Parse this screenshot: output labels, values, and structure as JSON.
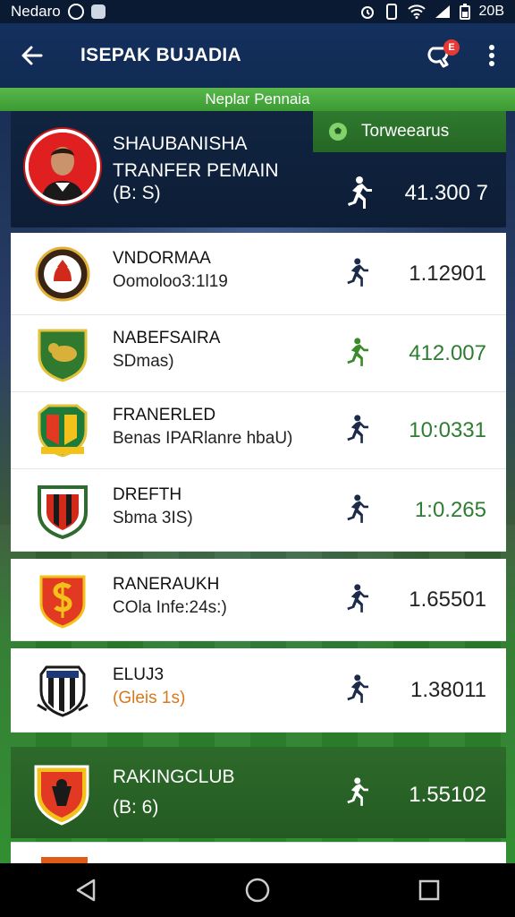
{
  "status_bar": {
    "carrier": "Nedaro",
    "time": "20B"
  },
  "app_bar": {
    "title": "ISEPAK BUJADIA",
    "notification_count": "E"
  },
  "banner": {
    "text": "Neplar Pennaia"
  },
  "player": {
    "name_line1": "SHAUBANISHA",
    "name_line2": "TRANFER PEMAIN",
    "stat": "(B: S)",
    "value": "41.300 7",
    "follow_label": "Torweearus"
  },
  "clubs": [
    {
      "name": "VNDORMAA",
      "sub": "Oomoloo3:1l19",
      "value": "1.12901",
      "value_color": "default",
      "sub_color": "default",
      "runner_color": "#1c2b4a"
    },
    {
      "name": "NABEFSAIRA",
      "sub": "SDmas)",
      "value": "412.007",
      "value_color": "green",
      "sub_color": "default",
      "runner_color": "#3a8a2a"
    },
    {
      "name": "FRANERLED",
      "sub": "Benas IPARlanre hbaU)",
      "value": "10:0331",
      "value_color": "green",
      "sub_color": "default",
      "runner_color": "#1c2b4a"
    },
    {
      "name": "DREFTH",
      "sub": "Sbma 3IS)",
      "value": "1:0.265",
      "value_color": "green",
      "sub_color": "default",
      "runner_color": "#1c2b4a"
    },
    {
      "name": "RANERAUKH",
      "sub": "COla Infe:24s:)",
      "value": "1.65501",
      "value_color": "default",
      "sub_color": "default",
      "runner_color": "#1c2b4a"
    },
    {
      "name": "ELUJ3",
      "sub": "(Gleis 1s)",
      "value": "1.38011",
      "value_color": "default",
      "sub_color": "orange",
      "runner_color": "#1c2b4a"
    }
  ],
  "featured_club": {
    "name": "RAKINGCLUB",
    "sub": "(B: 6)",
    "value": "1.55102"
  },
  "colors": {
    "app_bar": "#102a52",
    "banner_green": "#3b9a33",
    "value_green": "#2e7d32",
    "featured_green": "#245a22",
    "badge_red": "#e53935"
  },
  "icons": {
    "back": "arrow-left-icon",
    "notifications": "whistle-bell-icon",
    "more": "more-vertical-icon",
    "runner": "runner-icon",
    "follow": "football-icon"
  }
}
